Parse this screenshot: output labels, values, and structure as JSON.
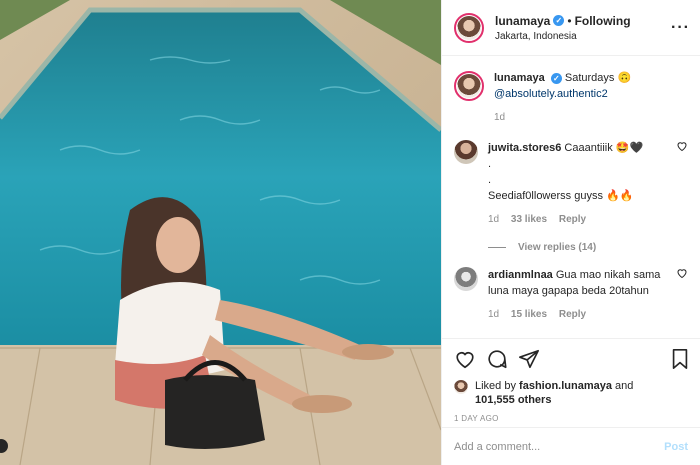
{
  "post": {
    "username": "lunamaya",
    "verified_mark": "✓",
    "separator": "•",
    "follow_status": "Following",
    "location": "Jakarta, Indonesia",
    "more_icon": "more-icon"
  },
  "caption": {
    "username": "lunamaya",
    "text": "Saturdays 🙃",
    "mention": "@absolutely.authentic2",
    "age": "1d"
  },
  "comments": [
    {
      "username": "juwita.stores6",
      "line1": "Caaantiiik 🤩🖤",
      "line2": ".",
      "line3": ".",
      "line4": "Seediaf0llowerss guyss 🔥🔥",
      "age": "1d",
      "likes": "33 likes",
      "reply": "Reply",
      "view_replies": "View replies (14)"
    },
    {
      "username": "ardianmlnaa",
      "text": "Gua mao nikah sama luna maya gapapa beda 20tahun",
      "age": "1d",
      "likes": "15 likes",
      "reply": "Reply"
    }
  ],
  "actions": {
    "liked_prefix": "Liked by",
    "liked_user": "fashion.lunamaya",
    "liked_and": "and",
    "others": "101,555 others",
    "time": "1 DAY AGO"
  },
  "add_comment": {
    "placeholder": "Add a comment...",
    "post_label": "Post"
  },
  "colors": {
    "accent": "#3897f0",
    "post_disabled": "#b2dffc",
    "meta": "#8e8e8e"
  }
}
